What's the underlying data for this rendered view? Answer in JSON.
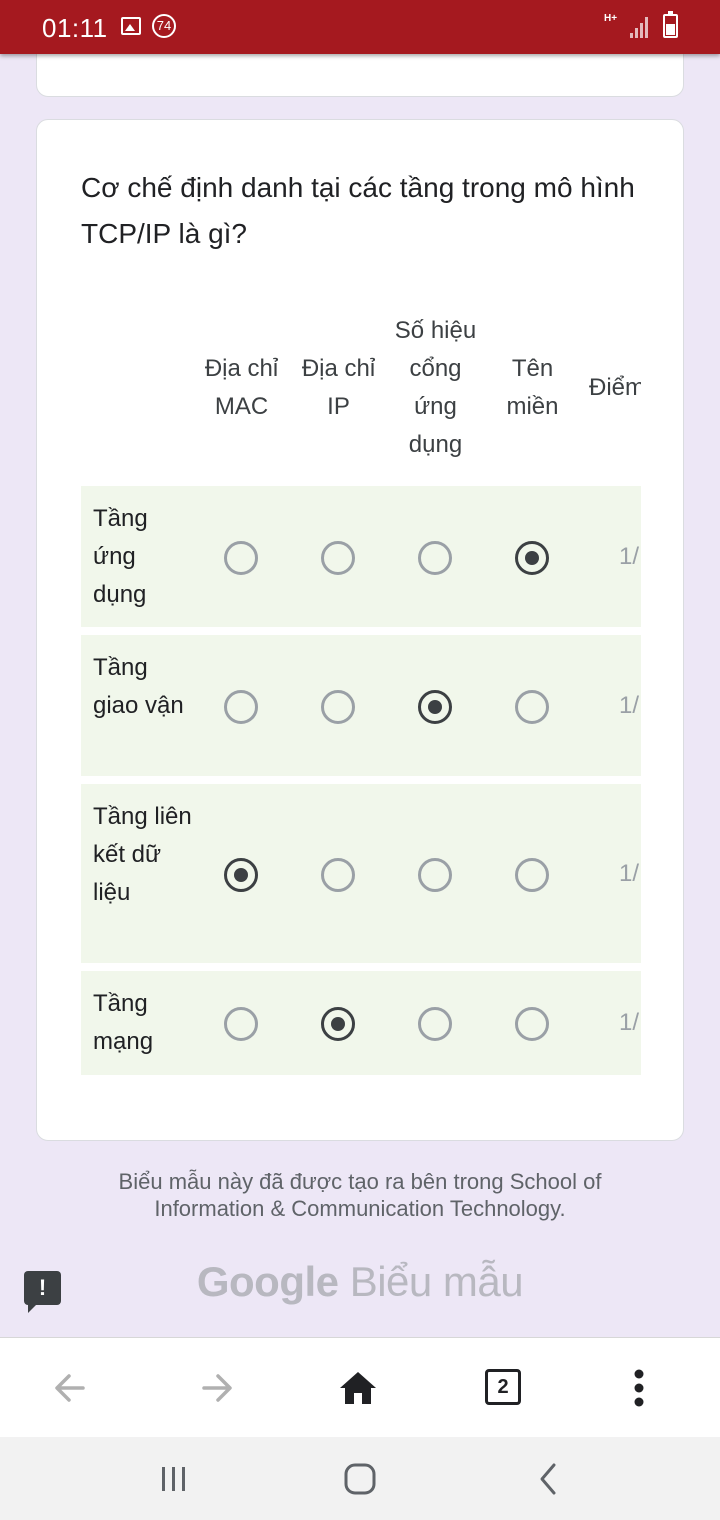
{
  "status_bar": {
    "time": "01:11",
    "badge_count": "74",
    "network_type": "H+"
  },
  "question": {
    "title": "Cơ chế định danh tại các tầng trong mô hình TCP/IP là gì?",
    "columns": [
      "Địa chỉ MAC",
      "Địa chỉ IP",
      "Số hiệu cổng ứng dụng",
      "Tên miền",
      "Điểm"
    ],
    "rows": [
      {
        "label": "Tầng ứng dụng",
        "selected": 3,
        "score": "1/"
      },
      {
        "label": "Tầng giao vận",
        "selected": 2,
        "score": "1/"
      },
      {
        "label": "Tầng liên kết dữ liệu",
        "selected": 0,
        "score": "1/"
      },
      {
        "label": "Tầng mạng",
        "selected": 1,
        "score": "1/"
      }
    ]
  },
  "footer": {
    "note": "Biểu mẫu này đã được tạo ra bên trong School of Information & Communication Technology.",
    "logo_google": "Google",
    "logo_product": "Biểu mẫu",
    "report_icon_glyph": "!"
  },
  "browser_nav": {
    "tab_count": "2"
  },
  "colors": {
    "status_bar": "#a5191f",
    "page_bg": "#ede7f6",
    "row_bg": "#f1f7eb"
  }
}
